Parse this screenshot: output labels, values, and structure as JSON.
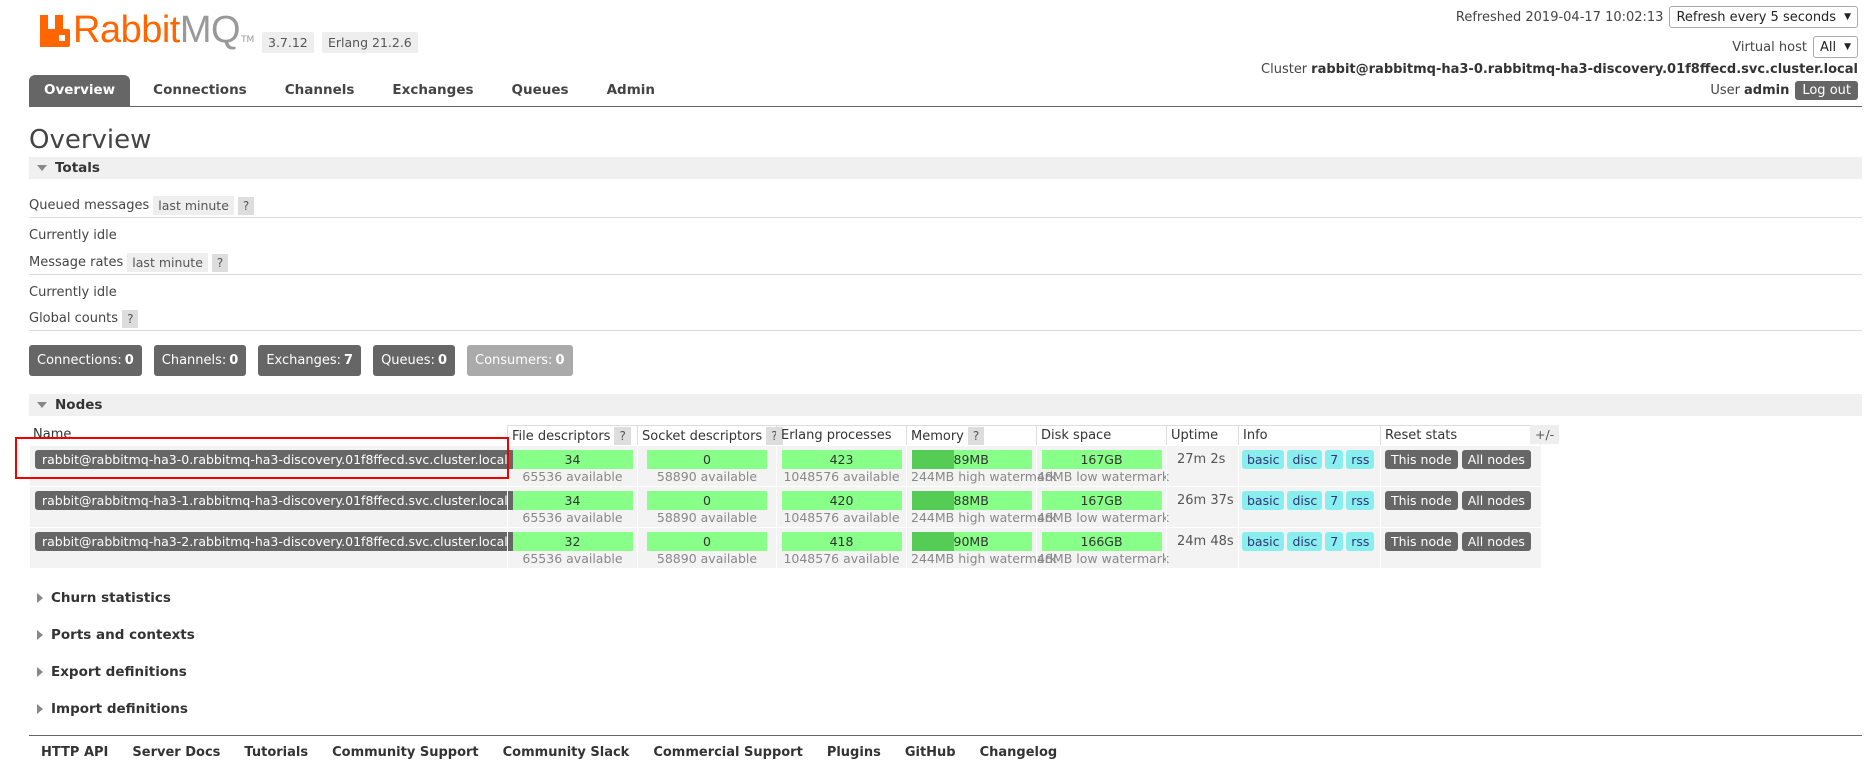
{
  "app": {
    "logo_text_rabbit": "Rabbit",
    "logo_text_mq": "MQ",
    "logo_tm": "TM",
    "version": "3.7.12",
    "erlang": "Erlang 21.2.6",
    "brand_color": "#ff6600"
  },
  "header": {
    "refreshed_label": "Refreshed 2019-04-17 10:02:13",
    "refresh_select": "Refresh every 5 seconds",
    "vhost_label": "Virtual host",
    "vhost_select": "All",
    "cluster_label": "Cluster",
    "cluster_name": "rabbit@rabbitmq-ha3-0.rabbitmq-ha3-discovery.01f8ffecd.svc.cluster.local",
    "user_label": "User",
    "user_name": "admin",
    "logout": "Log out"
  },
  "tabs": [
    "Overview",
    "Connections",
    "Channels",
    "Exchanges",
    "Queues",
    "Admin"
  ],
  "page_title": "Overview",
  "totals": {
    "title": "Totals",
    "queued_messages": "Queued messages",
    "message_rates": "Message rates",
    "last_minute": "last minute",
    "help": "?",
    "idle": "Currently idle",
    "global_counts": "Global counts",
    "counts": [
      {
        "label": "Connections:",
        "value": "0"
      },
      {
        "label": "Channels:",
        "value": "0"
      },
      {
        "label": "Exchanges:",
        "value": "7"
      },
      {
        "label": "Queues:",
        "value": "0"
      },
      {
        "label": "Consumers:",
        "value": "0"
      }
    ]
  },
  "nodes": {
    "title": "Nodes",
    "plus_minus": "+/-",
    "columns": [
      "Name",
      "File descriptors",
      "Socket descriptors",
      "Erlang processes",
      "Memory",
      "Disk space",
      "Uptime",
      "Info",
      "Reset stats"
    ],
    "rows": [
      {
        "name": "rabbit@rabbitmq-ha3-0.rabbitmq-ha3-discovery.01f8ffecd.svc.cluster.local",
        "fd": "34",
        "fd_avail": "65536 available",
        "sd": "0",
        "sd_avail": "58890 available",
        "ep": "423",
        "ep_avail": "1048576 available",
        "mem": "89MB",
        "mem_sub": "244MB high watermark",
        "disk": "167GB",
        "disk_sub": "48MB low watermark",
        "uptime": "27m 2s"
      },
      {
        "name": "rabbit@rabbitmq-ha3-1.rabbitmq-ha3-discovery.01f8ffecd.svc.cluster.local",
        "fd": "34",
        "fd_avail": "65536 available",
        "sd": "0",
        "sd_avail": "58890 available",
        "ep": "420",
        "ep_avail": "1048576 available",
        "mem": "88MB",
        "mem_sub": "244MB high watermark",
        "disk": "167GB",
        "disk_sub": "48MB low watermark",
        "uptime": "26m 37s"
      },
      {
        "name": "rabbit@rabbitmq-ha3-2.rabbitmq-ha3-discovery.01f8ffecd.svc.cluster.local",
        "fd": "32",
        "fd_avail": "65536 available",
        "sd": "0",
        "sd_avail": "58890 available",
        "ep": "418",
        "ep_avail": "1048576 available",
        "mem": "90MB",
        "mem_sub": "244MB high watermark",
        "disk": "166GB",
        "disk_sub": "48MB low watermark",
        "uptime": "24m 48s"
      }
    ],
    "info_chips": [
      "basic",
      "disc",
      "7",
      "rss"
    ],
    "reset_buttons": [
      "This node",
      "All nodes"
    ]
  },
  "sections": [
    "Churn statistics",
    "Ports and contexts",
    "Export definitions",
    "Import definitions"
  ],
  "footer": [
    "HTTP API",
    "Server Docs",
    "Tutorials",
    "Community Support",
    "Community Slack",
    "Commercial Support",
    "Plugins",
    "GitHub",
    "Changelog"
  ]
}
